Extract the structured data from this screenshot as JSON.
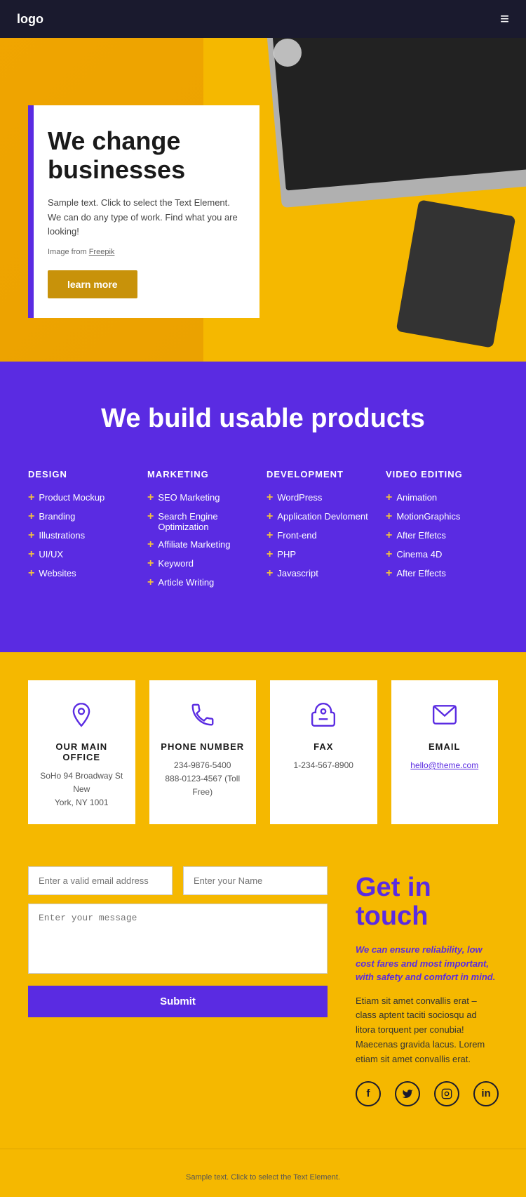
{
  "header": {
    "logo": "logo",
    "menu_icon": "≡"
  },
  "hero": {
    "title": "We change businesses",
    "body": "Sample text. Click to select the Text Element. We can do any type of work. Find what you are looking!",
    "image_credit": "Image from",
    "image_link": "Freepik",
    "cta": "learn more"
  },
  "products": {
    "title": "We build usable products",
    "columns": [
      {
        "heading": "DESIGN",
        "items": [
          "Product Mockup",
          "Branding",
          "Illustrations",
          "UI/UX",
          "Websites"
        ]
      },
      {
        "heading": "MARKETING",
        "items": [
          "SEO Marketing",
          "Search Engine Optimization",
          "Affiliate Marketing",
          "Keyword",
          "Article Writing"
        ]
      },
      {
        "heading": "DEVELOPMENT",
        "items": [
          "WordPress",
          "Application Devloment",
          "Front-end",
          "PHP",
          "Javascript"
        ]
      },
      {
        "heading": "VIDEO EDITING",
        "items": [
          "Animation",
          "MotionGraphics",
          "After Effetcs",
          "Cinema 4D",
          "After Effects"
        ]
      }
    ]
  },
  "contact_cards": [
    {
      "icon": "📍",
      "title": "OUR MAIN OFFICE",
      "lines": [
        "SoHo 94 Broadway St New",
        "York, NY 1001"
      ]
    },
    {
      "icon": "📞",
      "title": "PHONE NUMBER",
      "lines": [
        "234-9876-5400",
        "888-0123-4567 (Toll Free)"
      ]
    },
    {
      "icon": "☎",
      "title": "FAX",
      "lines": [
        "1-234-567-8900"
      ]
    },
    {
      "icon": "✉",
      "title": "EMAIL",
      "lines": [
        "hello@theme.com"
      ],
      "link": true
    }
  ],
  "contact_form": {
    "email_placeholder": "Enter a valid email address",
    "name_placeholder": "Enter your Name",
    "message_placeholder": "Enter your message",
    "submit_label": "Submit"
  },
  "get_in_touch": {
    "title": "Get in touch",
    "italic": "We can ensure reliability, low cost fares and most important, with safety and comfort in mind.",
    "body": "Etiam sit amet convallis erat – class aptent taciti sociosqu ad litora torquent per conubia! Maecenas gravida lacus. Lorem etiam sit amet convallis erat."
  },
  "social": {
    "icons": [
      "f",
      "t",
      "in",
      "li"
    ]
  },
  "footer": {
    "text": "Sample text. Click to select the Text Element."
  }
}
